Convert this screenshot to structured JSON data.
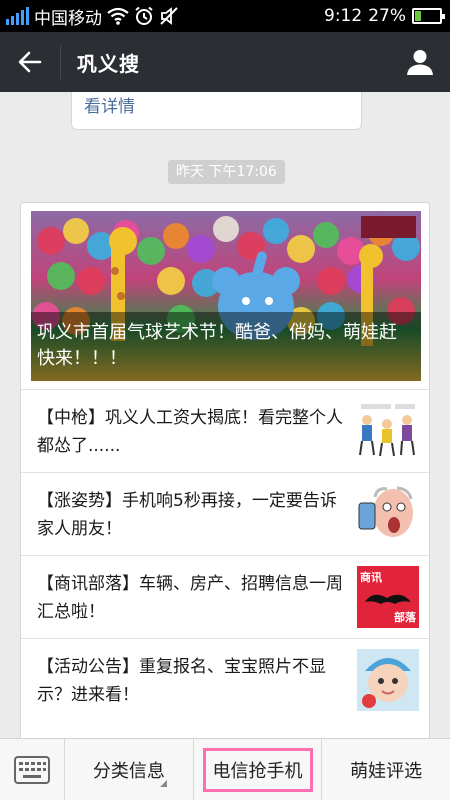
{
  "status_bar": {
    "carrier": "中国移动",
    "time": "9:12",
    "battery_percent": "27%",
    "battery_level": 0.27
  },
  "header": {
    "title": "巩义搜"
  },
  "chat": {
    "prev_card_link": "看详情",
    "timestamp": "昨天 下午17:06",
    "hero_title": "巩义市首届气球艺术节！酷爸、俏妈、萌娃赶快来！！！",
    "items": [
      {
        "title": "【中枪】巩义人工资大揭底！看完整个人都怂了......",
        "thumb": "cartoon-people"
      },
      {
        "title": "【涨姿势】手机响5秒再接，一定要告诉家人朋友！",
        "thumb": "surprised-man"
      },
      {
        "title": "【商讯部落】车辆、房产、招聘信息一周汇总啦！",
        "thumb": "mustache-logo"
      },
      {
        "title": "【活动公告】重复报名、宝宝照片不显示？进来看！",
        "thumb": "baby-photo"
      }
    ],
    "thumb_texts": {
      "mustache_top": "商讯",
      "mustache_bottom": "部落"
    }
  },
  "bottom_menu": {
    "items": [
      "分类信息",
      "电信抢手机",
      "萌娃评选"
    ]
  }
}
